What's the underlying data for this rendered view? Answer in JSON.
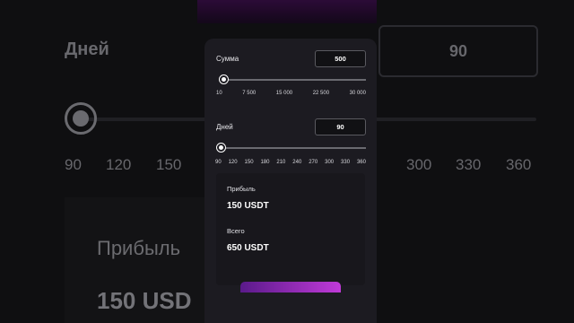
{
  "background": {
    "days_label": "Дней",
    "days_value": "90",
    "ticks": [
      "90",
      "120",
      "150",
      "",
      "",
      "",
      "",
      "",
      "300",
      "330",
      "360"
    ],
    "profit_label": "Прибыль",
    "profit_value": "150 USD"
  },
  "calculator": {
    "sum_label": "Сумма",
    "sum_value": "500",
    "sum_ticks": [
      "10",
      "7 500",
      "15 000",
      "22 500",
      "30 000"
    ],
    "sum_slider_fraction": 0.016,
    "days_label": "Дней",
    "days_value": "90",
    "days_ticks": [
      "90",
      "120",
      "150",
      "180",
      "210",
      "240",
      "270",
      "300",
      "330",
      "360"
    ],
    "days_slider_fraction": 0.0,
    "profit_label": "Прибыль",
    "profit_value": "150 USDT",
    "total_label": "Всего",
    "total_value": "650 USDT"
  },
  "colors": {
    "accent_start": "#5a1a8a",
    "accent_end": "#c03ad8"
  }
}
